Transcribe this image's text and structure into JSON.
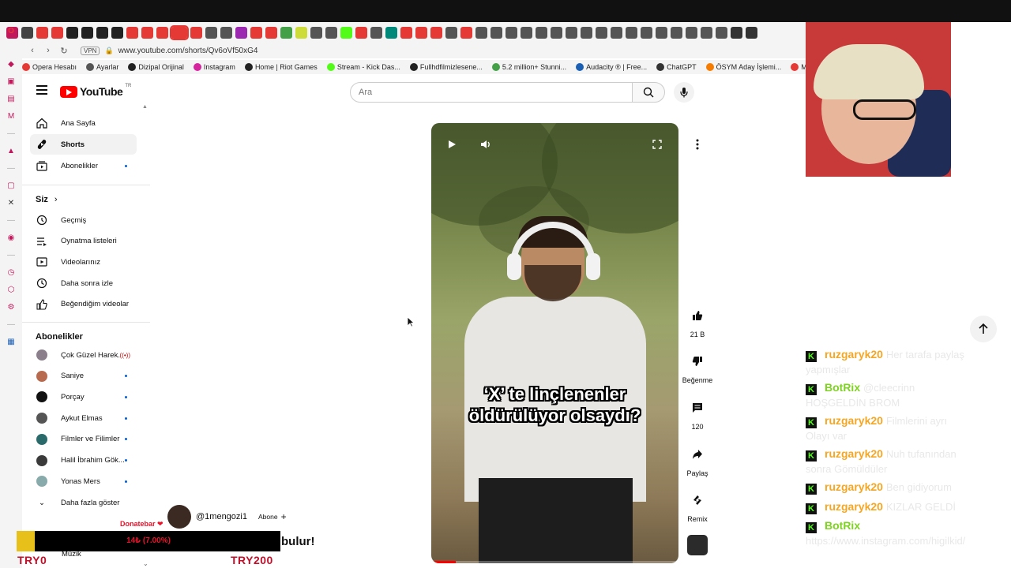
{
  "browser": {
    "url": "www.youtube.com/shorts/Qv6oVf50xG4",
    "vpn_label": "VPN",
    "tab_colors": [
      "#c2185b",
      "#444",
      "#e53935",
      "#e53935",
      "#222",
      "#222",
      "#222",
      "#222",
      "#e53935",
      "#e53935",
      "#e53935",
      "#e53935",
      "#e53935",
      "#555",
      "#555",
      "#9c27b0",
      "#e53935",
      "#e53935",
      "#43a047",
      "#cddc39",
      "#555",
      "#555",
      "#53fc18",
      "#e53935",
      "#555",
      "#00897b",
      "#e53935",
      "#e53935",
      "#e53935",
      "#555",
      "#e53935",
      "#555",
      "#555",
      "#555",
      "#555",
      "#555",
      "#555",
      "#555",
      "#555",
      "#555",
      "#555",
      "#555",
      "#555",
      "#555",
      "#555",
      "#555",
      "#555",
      "#555",
      "#333",
      "#333"
    ],
    "bookmarks": [
      {
        "label": "Opera Hesabı",
        "color": "#e53935"
      },
      {
        "label": "Ayarlar",
        "color": "#555"
      },
      {
        "label": "Dizipal Orijinal",
        "color": "#222"
      },
      {
        "label": "Instagram",
        "color": "#d6249f"
      },
      {
        "label": "Home | Riot Games",
        "color": "#222"
      },
      {
        "label": "Stream - Kick Das...",
        "color": "#53fc18"
      },
      {
        "label": "Fullhdfilmizlesene...",
        "color": "#222"
      },
      {
        "label": "5.2 million+ Stunni...",
        "color": "#43a047"
      },
      {
        "label": "Audacity ® | Free...",
        "color": "#1a5fb4"
      },
      {
        "label": "ChatGPT",
        "color": "#333"
      },
      {
        "label": "ÖSYM Aday İşlemi...",
        "color": "#f57c00"
      },
      {
        "label": "Minecra",
        "color": "#e53935"
      }
    ]
  },
  "youtube": {
    "logo_text": "YouTube",
    "logo_region": "TR",
    "search_placeholder": "Ara",
    "sidebar": {
      "main": [
        {
          "label": "Ana Sayfa",
          "icon": "home-icon",
          "active": false
        },
        {
          "label": "Shorts",
          "icon": "shorts-icon",
          "active": true
        },
        {
          "label": "Abonelikler",
          "icon": "subscriptions-icon",
          "active": false,
          "dot": true
        }
      ],
      "you_heading": "Siz",
      "you": [
        {
          "label": "Geçmiş",
          "icon": "history-icon"
        },
        {
          "label": "Oynatma listeleri",
          "icon": "playlist-icon"
        },
        {
          "label": "Videolarınız",
          "icon": "your-videos-icon"
        },
        {
          "label": "Daha sonra izle",
          "icon": "watch-later-icon"
        },
        {
          "label": "Beğendiğim videolar",
          "icon": "liked-icon"
        }
      ],
      "subs_heading": "Abonelikler",
      "subs": [
        {
          "label": "Çok Güzel Harek...",
          "color": "#8a7f8a",
          "live": "((•))"
        },
        {
          "label": "Saniye",
          "color": "#b86a4e",
          "dot": true
        },
        {
          "label": "Porçay",
          "color": "#111",
          "dot": true
        },
        {
          "label": "Aykut Elmas",
          "color": "#555",
          "dot": true
        },
        {
          "label": "Filmler ve Filimler",
          "color": "#2b6a6a",
          "dot": true
        },
        {
          "label": "Halil İbrahim Gök...",
          "color": "#3a3a3a",
          "dot": true
        },
        {
          "label": "Yonas Mers",
          "color": "#8aa",
          "dot": true
        }
      ],
      "show_more": "Daha fazla göster",
      "music": "Müzik"
    },
    "short": {
      "caption_line1": "‘X’ te linçlenenler",
      "caption_line2": "öldürülüyor olsaydı?",
      "progress": 0.1,
      "channel": "@1mengozi1",
      "subscribe": "Abone",
      "title_fragment": "bulur!",
      "likes": "21 B",
      "dislike_label": "Beğenme",
      "comments": "120",
      "share_label": "Paylaş",
      "remix_label": "Remix"
    }
  },
  "overlay": {
    "donate_label": "Donatebar",
    "donate_progress_text": "14₺ (7.00%)",
    "donate_progress": 0.07,
    "try_min": "TRY0",
    "try_max": "TRY200"
  },
  "chat": {
    "messages": [
      {
        "user": "ruzgaryk20",
        "color": "#f5a623",
        "text": "Her tarafa paylaş",
        "text2": "yapmışlar"
      },
      {
        "user": "BotRix",
        "color": "#7ed321",
        "text": "@cleecrinn",
        "text2": "HOŞGELDİN BROM"
      },
      {
        "user": "ruzgaryk20",
        "color": "#f5a623",
        "text": "Filmlerini ayrı",
        "text2": "Olayı var"
      },
      {
        "user": "ruzgaryk20",
        "color": "#f5a623",
        "text": "Nuh tufanından",
        "text2": "sonra Gömüldüler"
      },
      {
        "user": "ruzgaryk20",
        "color": "#f5a623",
        "text": "Ben gidiyorum"
      },
      {
        "user": "ruzgaryk20",
        "color": "#f5a623",
        "text": "KIZLAR GELDİ"
      },
      {
        "user": "BotRix",
        "color": "#7ed321",
        "text": "",
        "text2": "https://www.instagram.com/higilkid/"
      }
    ]
  }
}
